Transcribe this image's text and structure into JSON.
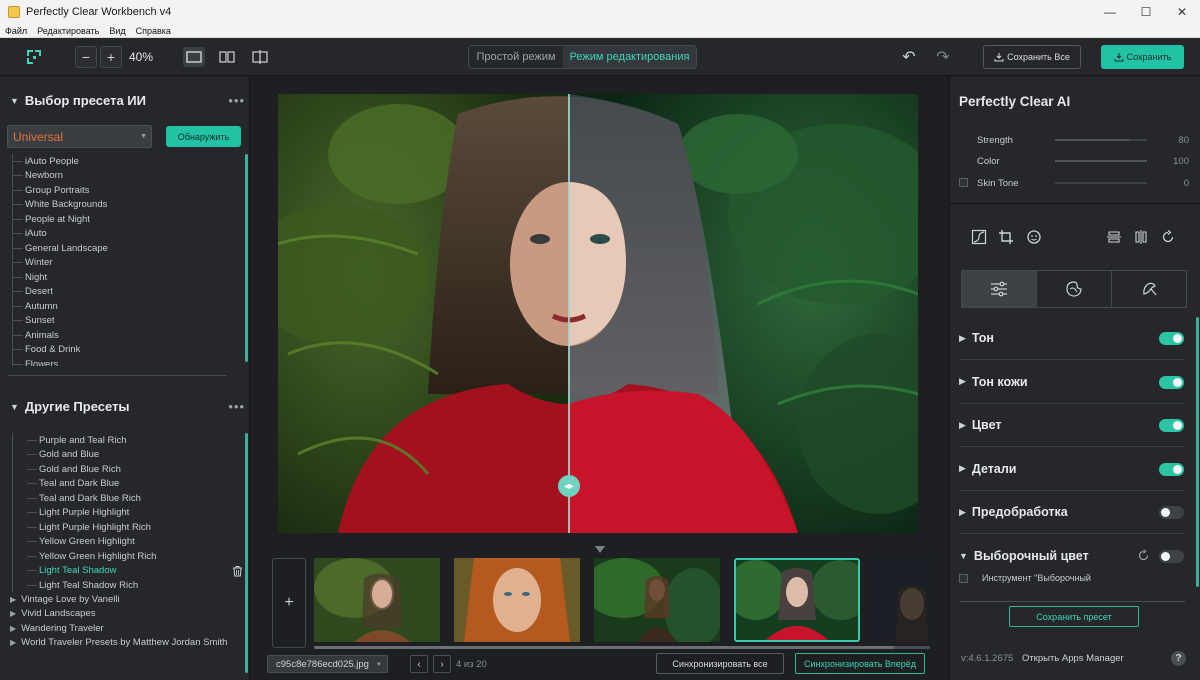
{
  "window": {
    "title": "Perfectly Clear Workbench v4",
    "controls": {
      "minimize": "—",
      "maximize": "☐",
      "close": "✕"
    }
  },
  "menu": [
    "Файл",
    "Редактировать",
    "Вид",
    "Справка"
  ],
  "toolbar": {
    "zoom": "40%",
    "zoom_out": "−",
    "zoom_in": "+",
    "mode_simple": "Простой режим",
    "mode_edit": "Режим редактирования",
    "save_all": "Сохранить Все",
    "save": "Сохранить"
  },
  "left": {
    "ai_preset_title": "Выбор пресета ИИ",
    "preset_selected": "Universal",
    "detect_button": "Обнаружить",
    "ai_presets": [
      "iAuto People",
      "Newborn",
      "Group Portraits",
      "White Backgrounds",
      "People at Night",
      "iAuto",
      "General Landscape",
      "Winter",
      "Night",
      "Desert",
      "Autumn",
      "Sunset",
      "Animals",
      "Food & Drink",
      "Flowers"
    ],
    "other_title": "Другие Пресеты",
    "other_presets": [
      "Purple and Teal Rich",
      "Gold and Blue",
      "Gold and Blue Rich",
      "Teal and Dark Blue",
      "Teal and Dark Blue Rich",
      "Light Purple Highlight",
      "Light Purple Highlight Rich",
      "Yellow Green Highlight",
      "Yellow Green Highlight Rich",
      "Light Teal Shadow",
      "Light Teal Shadow Rich"
    ],
    "active_preset": "Light Teal Shadow",
    "root_groups": [
      "Vintage Love by Vanelli",
      "Vivid Landscapes",
      "Wandering Traveler",
      "World Traveler Presets by Matthew Jordan Smith"
    ]
  },
  "center": {
    "file_name": "c95c8e786ecd025.jpg",
    "counter": "4 из 20",
    "sync_all": "Синхронизировать все",
    "sync_forward": "Синхронизировать Вперёд",
    "add_label": "+"
  },
  "right": {
    "title": "Perfectly Clear AI",
    "sliders": [
      {
        "label": "Strength",
        "value": "80",
        "level": 0.8
      },
      {
        "label": "Color",
        "value": "100",
        "level": 1.0
      },
      {
        "label": "Skin Tone",
        "value": "0",
        "level": 0.0
      }
    ],
    "sections": [
      {
        "name": "Тон",
        "enabled": true
      },
      {
        "name": "Тон кожи",
        "enabled": true
      },
      {
        "name": "Цвет",
        "enabled": true
      },
      {
        "name": "Детали",
        "enabled": true
      },
      {
        "name": "Предобработка",
        "enabled": false
      },
      {
        "name": "Выборочный цвет",
        "enabled": false
      }
    ],
    "selective_tool": "Инструмент \"Выборочный",
    "save_preset": "Сохранить пресет",
    "version": "v:4.6.1.2675",
    "apps_manager": "Открыть Apps Manager",
    "help": "?"
  },
  "colors": {
    "accent": "#22c3a4",
    "preset_orange": "#e4733a",
    "panel": "#25272b"
  }
}
